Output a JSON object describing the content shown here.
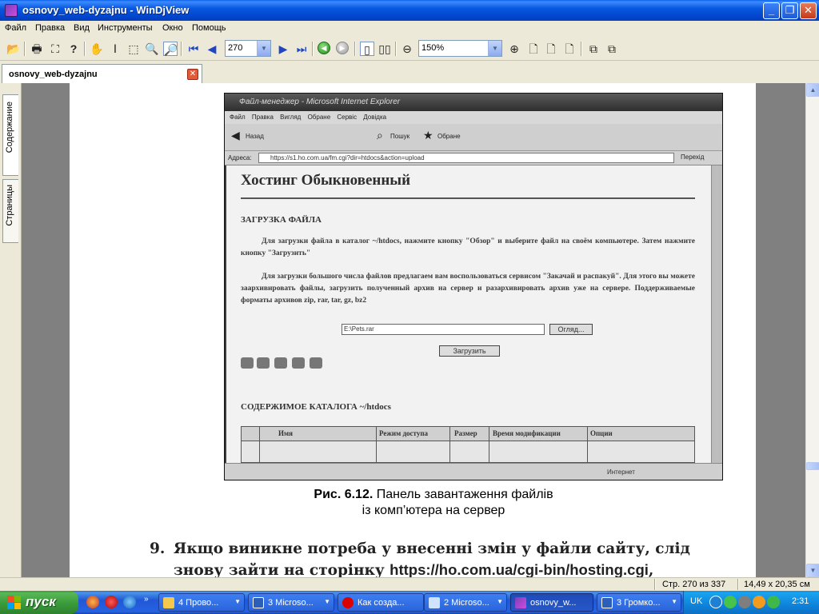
{
  "window": {
    "title": "osnovy_web-dyzajnu - WinDjView",
    "min_glyph": "_",
    "max_glyph": "❐",
    "close_glyph": "✕"
  },
  "menu": [
    "Файл",
    "Правка",
    "Вид",
    "Инструменты",
    "Окно",
    "Помощь"
  ],
  "toolbar": {
    "page_value": "270",
    "zoom_value": "150%"
  },
  "tab": {
    "label": "osnovy_web-dyzajnu",
    "close_glyph": "✕"
  },
  "side_tabs": {
    "contents": "Содержание",
    "pages": "Страницы"
  },
  "document": {
    "ie": {
      "title": "Файл-менеджер - Microsoft Internet Explorer",
      "menu": "Файл Правка Вигляд Обране Сервіс Довідка",
      "back": "Назад",
      "search": "Пошук",
      "favorites": "Обране",
      "address_label": "Адреса:",
      "address": "https://s1.ho.com.ua/fm.cgi?dir=htdocs&action=upload",
      "go": "Перехід",
      "heading": "Хостинг Обыкновенный",
      "upload_title": "ЗАГРУЗКА ФАЙЛА",
      "para1": "Для загрузки файла в каталог ~/htdocs, нажмите кнопку \"Обзор\" и выберите файл на своём компьютере. Затем нажмите кнопку \"Загрузить\"",
      "para2": "Для загрузки большого числа файлов предлагаем вам воспользоваться сервисом \"Закачай и распакуй\". Для этого вы можете заархивировать файлы, загрузить полученный архив на сервер и разархивировать архив уже на сервере. Поддерживаемые форматы архивов zip, rar, tar, gz, bz2",
      "file_value": "E:\\Pets.rar",
      "browse": "Огляд...",
      "upload": "Загрузить",
      "contents_title": "СОДЕРЖИМОЕ КАТАЛОГА ~/htdocs",
      "columns": [
        "Имя",
        "Режим доступа",
        "Размер",
        "Время модификации",
        "Опции"
      ],
      "status": "Интернет"
    },
    "caption_bold": "Рис. 6.12.",
    "caption_line1": "Панель завантаження файлів",
    "caption_line2": "із комп’ютера на сервер",
    "step_num": "9.",
    "step_line1": "Якщо виникне потреба у внесенні змін у файли сайту, слід",
    "step_line2_a": "знову зайти на сторінку ",
    "step_line2_url": "https://ho.com.ua/cgi-bin/hosting.cgi",
    "step_line2_b": ","
  },
  "status": {
    "page": "Стр. 270 из 337",
    "size": "14,49 x 20,35 см"
  },
  "taskbar": {
    "start": "пуск",
    "tasks": [
      {
        "label": "4 Прово...",
        "active": false
      },
      {
        "label": "3 Microso...",
        "active": false
      },
      {
        "label": "Как созда...",
        "active": false
      },
      {
        "label": "2 Microso...",
        "active": false
      },
      {
        "label": "osnovy_w...",
        "active": true
      },
      {
        "label": "3 Громко...",
        "active": false
      }
    ],
    "lang": "UK",
    "clock": "2:31"
  }
}
